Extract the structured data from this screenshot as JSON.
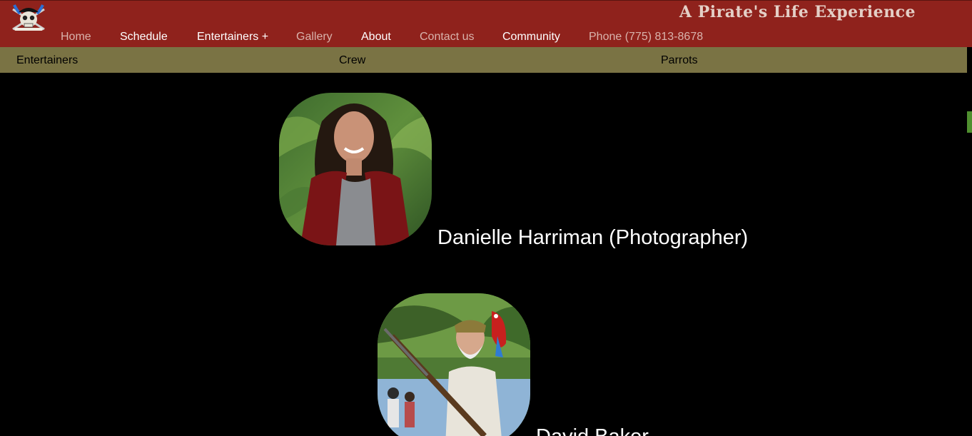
{
  "header": {
    "site_title": "A Pirate's Life Experience",
    "logo_icon": "pirate-skull-logo",
    "nav": [
      {
        "label": "Home",
        "style": "dim"
      },
      {
        "label": "Schedule",
        "style": "bright"
      },
      {
        "label": "Entertainers +",
        "style": "bright"
      },
      {
        "label": "Gallery",
        "style": "dim"
      },
      {
        "label": "About",
        "style": "bright"
      },
      {
        "label": "Contact us",
        "style": "dim"
      },
      {
        "label": "Community",
        "style": "bright"
      },
      {
        "label": "Phone (775) 813-8678",
        "style": "dim"
      }
    ]
  },
  "subnav": [
    "Entertainers",
    "Crew",
    "Parrots"
  ],
  "crew": [
    {
      "name": "Danielle Harriman (Photographer)"
    },
    {
      "name": "David Baker"
    }
  ],
  "colors": {
    "header_bg": "#8f221c",
    "subnav_bg": "#7a7344",
    "page_bg": "#000000",
    "title_text": "#e4cfc6"
  }
}
